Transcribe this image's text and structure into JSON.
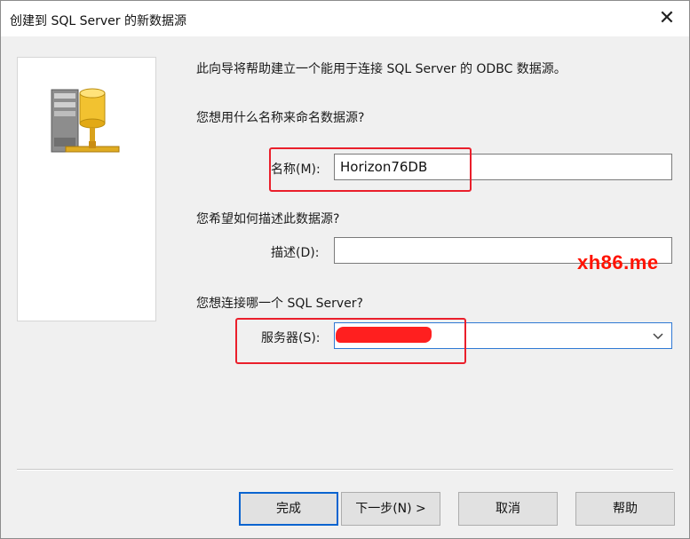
{
  "window": {
    "title": "创建到 SQL Server 的新数据源",
    "close_glyph": "✕"
  },
  "main": {
    "intro": "此向导将帮助建立一个能用于连接 SQL Server 的 ODBC 数据源。",
    "name_question": "您想用什么名称来命名数据源?",
    "name_label": "名称(M):",
    "name_value": "Horizon76DB",
    "desc_question": "您希望如何描述此数据源?",
    "desc_label": "描述(D):",
    "desc_value": "",
    "server_question": "您想连接哪一个 SQL Server?",
    "server_label": "服务器(S):",
    "server_value": ""
  },
  "watermark": "xh86.me",
  "buttons": {
    "finish": "完成",
    "next": "下一步(N) >",
    "cancel": "取消",
    "help": "帮助"
  },
  "colors": {
    "highlight": "#ea1f2b",
    "redaction": "#ff1f1f",
    "watermark": "#ff1200",
    "focus_border": "#0a64d0"
  },
  "icons": {
    "wizard_image": "database-server-icon",
    "dropdown": "chevron-down-icon"
  }
}
